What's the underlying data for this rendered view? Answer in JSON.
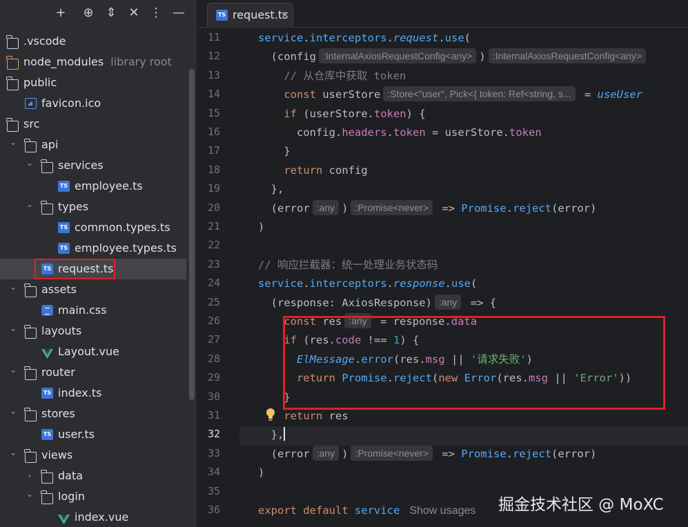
{
  "sidebar": {
    "toolbar_icons": [
      "add-icon",
      "locate-icon",
      "expand-all-icon",
      "collapse-all-icon",
      "more-options-icon",
      "hide-icon"
    ],
    "tree": [
      {
        "label": "vscode",
        "prefix": ".",
        "icon": "folder-icon",
        "depth": 0,
        "expanded": null
      },
      {
        "label": "node_modules",
        "note": "library root",
        "icon": "library-folder-icon",
        "depth": 0,
        "expanded": null
      },
      {
        "label": "public",
        "icon": "folder-icon",
        "depth": 0,
        "expanded": null
      },
      {
        "label": "favicon.ico",
        "icon": "image-file-icon",
        "depth": 1,
        "expanded": null
      },
      {
        "label": "src",
        "icon": "folder-icon",
        "depth": 0,
        "expanded": null
      },
      {
        "label": "api",
        "icon": "folder-icon",
        "depth": 1,
        "expanded": true
      },
      {
        "label": "services",
        "icon": "folder-icon",
        "depth": 2,
        "expanded": true
      },
      {
        "label": "employee.ts",
        "icon": "ts-file-icon",
        "depth": 3,
        "expanded": null
      },
      {
        "label": "types",
        "icon": "folder-icon",
        "depth": 2,
        "expanded": true
      },
      {
        "label": "common.types.ts",
        "icon": "ts-file-icon",
        "depth": 3,
        "expanded": null
      },
      {
        "label": "employee.types.ts",
        "icon": "ts-file-icon",
        "depth": 3,
        "expanded": null
      },
      {
        "label": "request.ts",
        "icon": "ts-file-icon",
        "depth": 2,
        "expanded": null,
        "selected": true
      },
      {
        "label": "assets",
        "icon": "folder-icon",
        "depth": 1,
        "expanded": true
      },
      {
        "label": "main.css",
        "icon": "css-file-icon",
        "depth": 2,
        "expanded": null
      },
      {
        "label": "layouts",
        "icon": "folder-icon",
        "depth": 1,
        "expanded": true
      },
      {
        "label": "Layout.vue",
        "icon": "vue-file-icon",
        "depth": 2,
        "expanded": null
      },
      {
        "label": "router",
        "icon": "folder-icon",
        "depth": 1,
        "expanded": true
      },
      {
        "label": "index.ts",
        "icon": "ts-file-icon",
        "depth": 2,
        "expanded": null
      },
      {
        "label": "stores",
        "icon": "folder-icon",
        "depth": 1,
        "expanded": true
      },
      {
        "label": "user.ts",
        "icon": "ts-file-icon",
        "depth": 2,
        "expanded": null
      },
      {
        "label": "views",
        "icon": "folder-icon",
        "depth": 1,
        "expanded": true
      },
      {
        "label": "data",
        "icon": "folder-icon",
        "depth": 2,
        "expanded": false
      },
      {
        "label": "login",
        "icon": "folder-icon",
        "depth": 2,
        "expanded": true
      },
      {
        "label": "index.vue",
        "icon": "vue-file-icon",
        "depth": 3,
        "expanded": null
      }
    ]
  },
  "editor": {
    "tab": {
      "label": "request.ts",
      "close": "✕",
      "icon_text": "TS"
    },
    "current_line": 32,
    "lines": [
      {
        "n": 11,
        "parts": [
          [
            "fn",
            "service"
          ],
          [
            "plain",
            "."
          ],
          [
            "fn",
            "interceptors"
          ],
          [
            "plain",
            "."
          ],
          [
            "fn ital",
            "request"
          ],
          [
            "plain",
            "."
          ],
          [
            "fn",
            "use"
          ],
          [
            "plain",
            "("
          ]
        ]
      },
      {
        "n": 12,
        "parts": [
          [
            "plain",
            "  (config"
          ],
          [
            "hint",
            ":InternalAxiosRequestConfig<any>"
          ],
          [
            "plain",
            ")"
          ],
          [
            "hint",
            ":InternalAxiosRequestConfig<any>"
          ]
        ]
      },
      {
        "n": 13,
        "parts": [
          [
            "cmt",
            "    // 从仓库中获取 token"
          ]
        ]
      },
      {
        "n": 14,
        "parts": [
          [
            "kw",
            "    const "
          ],
          [
            "plain",
            "userStore"
          ],
          [
            "hint",
            ":Store<\"user\", Pick<{ token: Ref<string, s..."
          ],
          [
            "plain",
            " = "
          ],
          [
            "fn ital",
            "useUser"
          ]
        ]
      },
      {
        "n": 15,
        "parts": [
          [
            "kw",
            "    if "
          ],
          [
            "plain",
            "(userStore."
          ],
          [
            "prop",
            "token"
          ],
          [
            "plain",
            ") {"
          ]
        ]
      },
      {
        "n": 16,
        "parts": [
          [
            "plain",
            "      config."
          ],
          [
            "prop",
            "headers"
          ],
          [
            "plain",
            "."
          ],
          [
            "prop",
            "token"
          ],
          [
            "plain",
            " = userStore."
          ],
          [
            "prop",
            "token"
          ]
        ]
      },
      {
        "n": 17,
        "parts": [
          [
            "plain",
            "    }"
          ]
        ]
      },
      {
        "n": 18,
        "parts": [
          [
            "kw",
            "    return "
          ],
          [
            "plain",
            "config"
          ]
        ]
      },
      {
        "n": 19,
        "parts": [
          [
            "plain",
            "  },"
          ]
        ]
      },
      {
        "n": 20,
        "parts": [
          [
            "plain",
            "  (error"
          ],
          [
            "hint",
            ":any"
          ],
          [
            "plain",
            ")"
          ],
          [
            "hint",
            ":Promise<never>"
          ],
          [
            "plain",
            " => "
          ],
          [
            "cls",
            "Promise"
          ],
          [
            "plain",
            "."
          ],
          [
            "fn",
            "reject"
          ],
          [
            "plain",
            "(error)"
          ]
        ]
      },
      {
        "n": 21,
        "parts": [
          [
            "plain",
            ")"
          ]
        ]
      },
      {
        "n": 22,
        "parts": []
      },
      {
        "n": 23,
        "parts": [
          [
            "cmt",
            "// 响应拦截器：统一处理业务状态码"
          ]
        ]
      },
      {
        "n": 24,
        "parts": [
          [
            "fn",
            "service"
          ],
          [
            "plain",
            "."
          ],
          [
            "fn",
            "interceptors"
          ],
          [
            "plain",
            "."
          ],
          [
            "fn ital",
            "response"
          ],
          [
            "plain",
            "."
          ],
          [
            "fn",
            "use"
          ],
          [
            "plain",
            "("
          ]
        ]
      },
      {
        "n": 25,
        "parts": [
          [
            "plain",
            "  (response: AxiosResponse)"
          ],
          [
            "hint",
            ":any"
          ],
          [
            "plain",
            " => {"
          ]
        ]
      },
      {
        "n": 26,
        "parts": [
          [
            "kw",
            "    const "
          ],
          [
            "plain",
            "res"
          ],
          [
            "hint",
            ":any"
          ],
          [
            "plain",
            " = response."
          ],
          [
            "prop",
            "data"
          ]
        ]
      },
      {
        "n": 27,
        "parts": [
          [
            "kw",
            "    if "
          ],
          [
            "plain",
            "(res."
          ],
          [
            "prop",
            "code"
          ],
          [
            "plain",
            " !== "
          ],
          [
            "num",
            "1"
          ],
          [
            "plain",
            ") {"
          ]
        ]
      },
      {
        "n": 28,
        "parts": [
          [
            "fn ital",
            "      ElMessage"
          ],
          [
            "plain",
            "."
          ],
          [
            "fn",
            "error"
          ],
          [
            "plain",
            "(res."
          ],
          [
            "prop",
            "msg"
          ],
          [
            "plain",
            " || "
          ],
          [
            "str",
            "'请求失败'"
          ],
          [
            "plain",
            ")"
          ]
        ]
      },
      {
        "n": 29,
        "parts": [
          [
            "kw",
            "      return "
          ],
          [
            "cls",
            "Promise"
          ],
          [
            "plain",
            "."
          ],
          [
            "fn",
            "reject"
          ],
          [
            "plain",
            "("
          ],
          [
            "kw",
            "new "
          ],
          [
            "cls",
            "Error"
          ],
          [
            "plain",
            "(res."
          ],
          [
            "prop",
            "msg"
          ],
          [
            "plain",
            " || "
          ],
          [
            "str",
            "'Error'"
          ],
          [
            "plain",
            "))"
          ]
        ]
      },
      {
        "n": 30,
        "parts": [
          [
            "plain",
            "    }"
          ]
        ]
      },
      {
        "n": 31,
        "parts": [
          [
            "kw",
            "    return "
          ],
          [
            "plain",
            "res"
          ]
        ]
      },
      {
        "n": 32,
        "parts": [
          [
            "plain",
            "  },"
          ],
          [
            "caret",
            ""
          ]
        ]
      },
      {
        "n": 33,
        "parts": [
          [
            "plain",
            "  (error"
          ],
          [
            "hint",
            ":any"
          ],
          [
            "plain",
            ")"
          ],
          [
            "hint",
            ":Promise<never>"
          ],
          [
            "plain",
            " => "
          ],
          [
            "cls",
            "Promise"
          ],
          [
            "plain",
            "."
          ],
          [
            "fn",
            "reject"
          ],
          [
            "plain",
            "(error)"
          ]
        ]
      },
      {
        "n": 34,
        "parts": [
          [
            "plain",
            ")"
          ]
        ]
      },
      {
        "n": 35,
        "parts": []
      },
      {
        "n": 36,
        "parts": [
          [
            "kw",
            "export default "
          ],
          [
            "fn",
            "service"
          ],
          [
            "usages",
            "Show usages"
          ]
        ]
      }
    ]
  },
  "watermark": "掘金技术社区 @ MoXC"
}
